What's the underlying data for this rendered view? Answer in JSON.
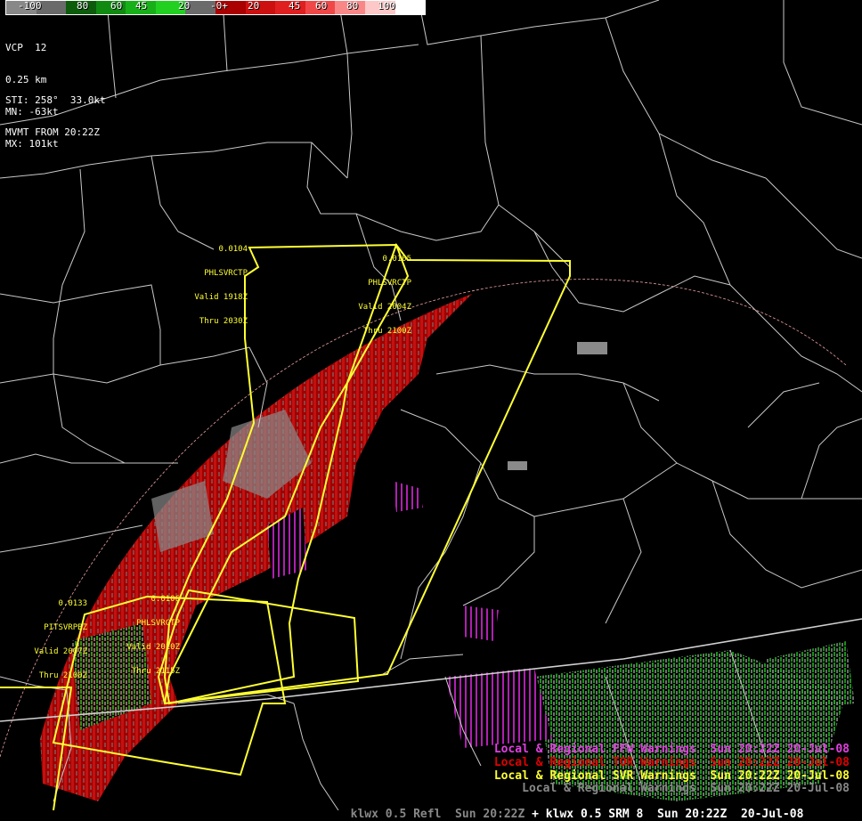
{
  "colorbar": {
    "labels": [
      "-100",
      "80",
      "60",
      "45",
      "20",
      "-0+",
      "20",
      "45",
      "60",
      "80",
      "100"
    ],
    "colors": [
      "#888888",
      "#6a6a6a",
      "#0c5c0c",
      "#118a11",
      "#18b018",
      "#22d022",
      "#6b6b6b",
      "#aa0000",
      "#cc1010",
      "#e02020",
      "#f04848",
      "#f88888",
      "#fcc8c8",
      "#ffffff"
    ]
  },
  "info": {
    "vcp": "VCP  12",
    "elev": "0.25 km",
    "mn": "MN: -63kt",
    "mx": "MX: 101kt",
    "sti": "STI: 258°  33.0kt",
    "mvmt": "MVMT FROM 20:22Z"
  },
  "warnings": [
    {
      "id": "0.0104",
      "product": "PHLSVRCTP",
      "valid": "Valid 1918Z",
      "thru": "Thru 2030Z"
    },
    {
      "id": "0.0105",
      "product": "PHLSVRCTP",
      "valid": "Valid 2004Z",
      "thru": "Thru 2100Z"
    },
    {
      "id": "0.0133",
      "product": "PITSVRPBZ",
      "valid": "Valid 2007Z",
      "thru": "Thru 2100Z"
    },
    {
      "id": "0.0106",
      "product": "PHLSVRCTP",
      "valid": "Valid 2010Z",
      "thru": "Thru 2115Z"
    }
  ],
  "legend": [
    {
      "text": "Local & Regional FFW Warnings  Sun 20:22Z 20-Jul-08",
      "color": "#e040e0"
    },
    {
      "text": "Local & Regional TOR Warnings  Sun 20:22Z 20-Jul-08",
      "color": "#e00000"
    },
    {
      "text": "Local & Regional SVR Warnings  Sun 20:22Z 20-Jul-08",
      "color": "#ffff33"
    },
    {
      "text": "Local & Regional Warnings  Sun 20:22Z 20-Jul-08",
      "color": "#888888"
    }
  ],
  "footer": {
    "left": "klwx 0.5 Refl  Sun 20:22Z",
    "right": " + klwx 0.5 SRM 8  Sun 20:22Z  20-Jul-08"
  }
}
